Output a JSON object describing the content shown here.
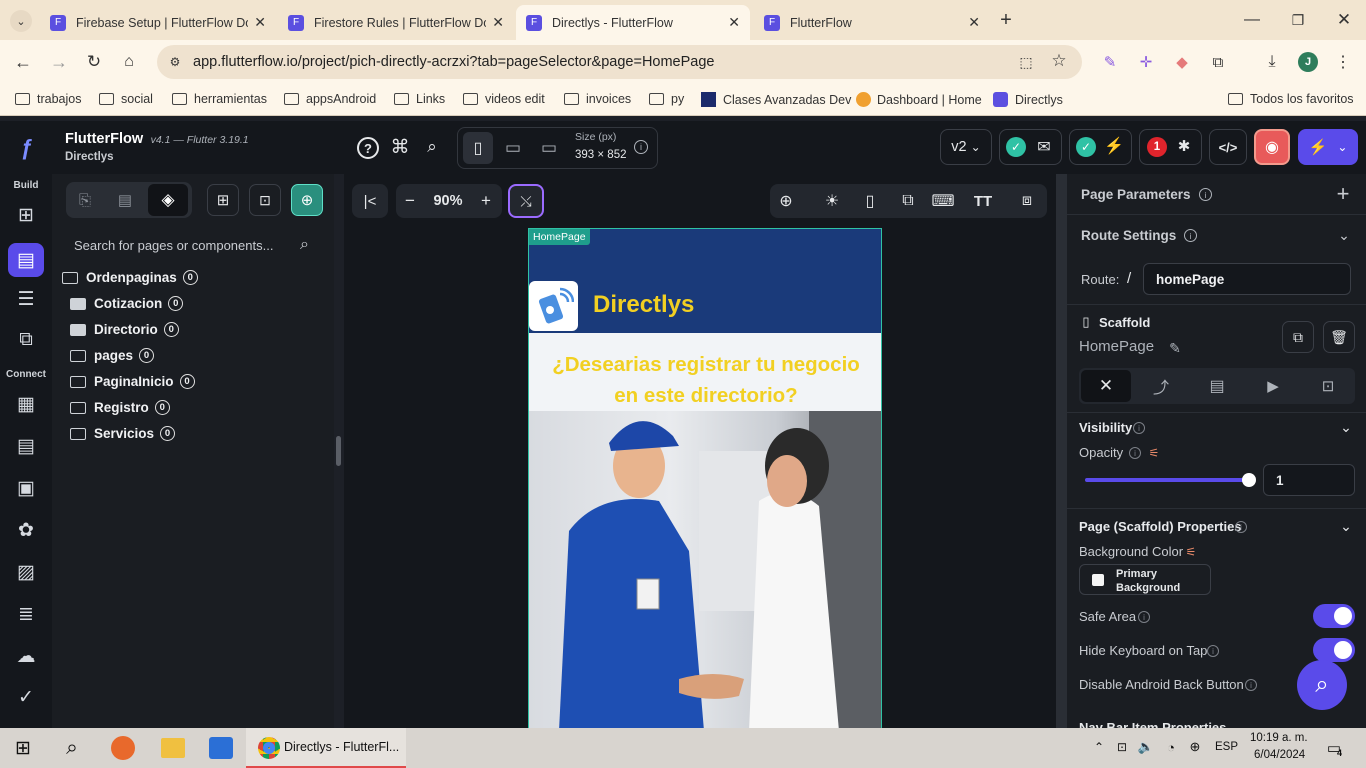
{
  "browser": {
    "tabs": [
      {
        "title": "Firebase Setup | FlutterFlow Do",
        "icon": "flutterflow-icon"
      },
      {
        "title": "Firestore Rules | FlutterFlow Do",
        "icon": "flutterflow-icon"
      },
      {
        "title": "Directlys - FlutterFlow",
        "icon": "flutterflow-icon"
      },
      {
        "title": "FlutterFlow",
        "icon": "flutterflow-icon"
      }
    ],
    "url": "app.flutterflow.io/project/pich-directly-acrzxi?tab=pageSelector&page=HomePage",
    "profile_initial": "J",
    "bookmarks": [
      "trabajos",
      "social",
      "herramientas",
      "appsAndroid",
      "Links",
      "videos edit",
      "invoices",
      "py",
      "Clases Avanzadas Dev",
      "Dashboard | Home",
      "Directlys"
    ],
    "all_favorites": "Todos los favoritos"
  },
  "ff": {
    "app_name": "FlutterFlow",
    "version": "v4.1 — Flutter 3.19.1",
    "project": "Directlys",
    "size_label": "Size (px)",
    "size_value": "393 × 852",
    "branch": "v2",
    "issues_count": "1",
    "zoom": "90%",
    "rail": {
      "build": "Build",
      "connect": "Connect"
    },
    "search_placeholder": "Search for pages or components...",
    "tree": [
      {
        "label": "Ordenpaginas",
        "count": "0",
        "open": true
      },
      {
        "label": "Cotizacion",
        "count": "0"
      },
      {
        "label": "Directorio",
        "count": "0"
      },
      {
        "label": "pages",
        "count": "0",
        "open": true
      },
      {
        "label": "PaginaInicio",
        "count": "0",
        "open": true
      },
      {
        "label": "Registro",
        "count": "0",
        "open": true
      },
      {
        "label": "Servicios",
        "count": "0",
        "open": true
      }
    ],
    "preview": {
      "page_badge": "HomePage",
      "app_title": "Directlys",
      "headline": "¿Desearias registrar tu negocio en este  directorio?"
    },
    "props": {
      "page_parameters": "Page Parameters",
      "route_settings": "Route Settings",
      "route_label": "Route:",
      "route_slash": "/",
      "route_value": "homePage",
      "scaffold": "Scaffold",
      "page_name": "HomePage",
      "visibility": "Visibility",
      "opacity": "Opacity",
      "opacity_value": "1",
      "scaffold_props": "Page (Scaffold) Properties",
      "bg_color": "Background Color",
      "bg_value": "Primary Background",
      "safe_area": "Safe Area",
      "hide_kb": "Hide Keyboard on Tap",
      "disable_back": "Disable Android Back Button",
      "nav_bar": "Nav Bar Item Properties"
    }
  },
  "taskbar": {
    "app": "Directlys - FlutterFl...",
    "lang": "ESP",
    "time": "10:19 a. m.",
    "date": "6/04/2024",
    "notif": "4"
  },
  "colors": {
    "accent": "#5a4bea",
    "appbar": "#1a3a7a",
    "title_yellow": "#f2d022",
    "teal": "#1f9e8c"
  }
}
